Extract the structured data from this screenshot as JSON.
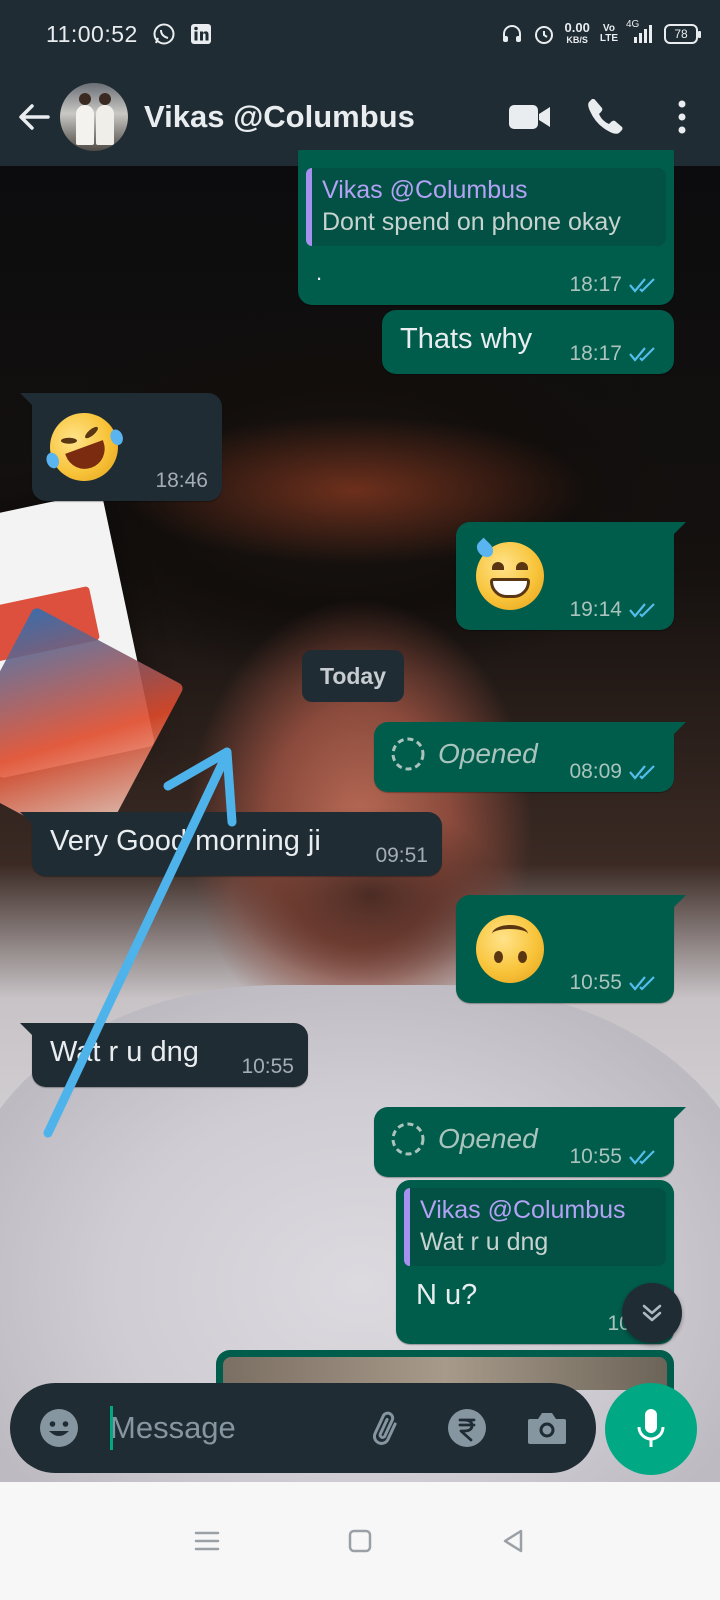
{
  "status_bar": {
    "time": "11:00:52",
    "net_speed": "0.00",
    "net_unit": "KB/S",
    "volte_top": "Vo",
    "volte_bottom": "LTE",
    "network": "4G",
    "battery": "78",
    "icons": [
      "whatsapp-icon",
      "linkedin-icon",
      "headphones-icon",
      "alarm-icon",
      "signal-icon",
      "battery-icon"
    ]
  },
  "header": {
    "contact_name": "Vikas @Columbus",
    "icons": [
      "back-arrow-icon",
      "video-call-icon",
      "voice-call-icon",
      "more-options-icon"
    ]
  },
  "messages": [
    {
      "id": "m1",
      "dir": "out",
      "quote_author": "Vikas @Columbus",
      "quote_text": "Dont spend on phone okay",
      "text": ".",
      "time": "18:17",
      "status": "read"
    },
    {
      "id": "m2",
      "dir": "out",
      "text": "Thats why",
      "time": "18:17",
      "status": "read"
    },
    {
      "id": "m3",
      "dir": "in",
      "emoji": "rolling-on-floor-laughing",
      "time": "18:46"
    },
    {
      "id": "m4",
      "dir": "out",
      "emoji": "grinning-sweat",
      "time": "19:14",
      "status": "read"
    },
    {
      "id": "date1",
      "type": "date",
      "text": "Today"
    },
    {
      "id": "m5",
      "dir": "out",
      "view_once": true,
      "text": "Opened",
      "time": "08:09",
      "status": "read"
    },
    {
      "id": "m6",
      "dir": "in",
      "text": "Very Good morning ji",
      "time": "09:51"
    },
    {
      "id": "m7",
      "dir": "out",
      "emoji": "upside-down-face",
      "time": "10:55",
      "status": "read"
    },
    {
      "id": "m8",
      "dir": "in",
      "text": "Wat r u dng",
      "time": "10:55"
    },
    {
      "id": "m9",
      "dir": "out",
      "view_once": true,
      "text": "Opened",
      "time": "10:55",
      "status": "read"
    },
    {
      "id": "m10",
      "dir": "out",
      "quote_author": "Vikas @Columbus",
      "quote_text": "Wat r u dng",
      "text": "N u?",
      "time": "10:56",
      "status": "read"
    }
  ],
  "input": {
    "placeholder": "Message",
    "icons": [
      "emoji-icon",
      "attach-icon",
      "rupee-payment-icon",
      "camera-icon",
      "mic-icon"
    ]
  },
  "colors": {
    "header_bg": "#1f2c34",
    "outgoing_bubble": "#005c4b",
    "incoming_bubble": "#1f2c34",
    "accent": "#00a884",
    "read_ticks": "#53bdeb",
    "quote_author": "#a791f0",
    "annotation_arrow": "#4db3ea"
  }
}
